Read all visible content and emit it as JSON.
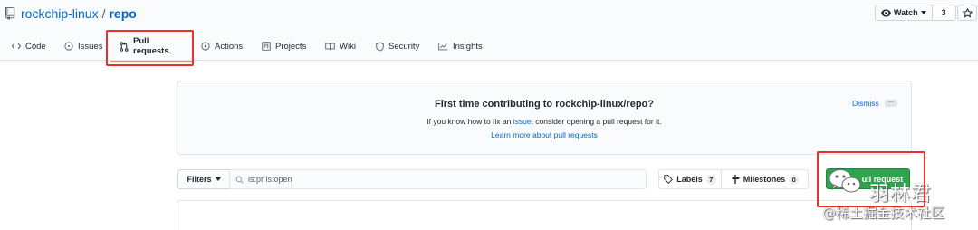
{
  "repo": {
    "owner": "rockchip-linux",
    "separator": "/",
    "name": "repo"
  },
  "watch": {
    "label": "Watch",
    "count": "3"
  },
  "tabs": [
    {
      "label": "Code",
      "icon": "code-icon"
    },
    {
      "label": "Issues",
      "icon": "issue-icon"
    },
    {
      "label": "Pull requests",
      "icon": "pull-request-icon",
      "selected": true
    },
    {
      "label": "Actions",
      "icon": "play-icon"
    },
    {
      "label": "Projects",
      "icon": "project-icon"
    },
    {
      "label": "Wiki",
      "icon": "book-icon"
    },
    {
      "label": "Security",
      "icon": "shield-icon"
    },
    {
      "label": "Insights",
      "icon": "graph-icon"
    }
  ],
  "banner": {
    "title": "First time contributing to rockchip-linux/repo?",
    "text_before": "If you know how to fix an ",
    "text_link": "issue",
    "text_after": ", consider opening a pull request for it.",
    "learn_more": "Learn more about pull requests",
    "dismiss": "Dismiss",
    "more": "..."
  },
  "filter_bar": {
    "filters_label": "Filters",
    "search_value": "is:pr is:open",
    "labels_label": "Labels",
    "labels_count": "7",
    "milestones_label": "Milestones",
    "milestones_count": "0",
    "new_pr_label": "ull request"
  },
  "watermark": {
    "brand": "羽林君",
    "site": "@稀土掘金技术社区"
  },
  "colors": {
    "link": "#0366d6",
    "selected_tab_underline": "#f9826c",
    "primary_button": "#2ea44f",
    "highlight_box": "#e8312c"
  }
}
